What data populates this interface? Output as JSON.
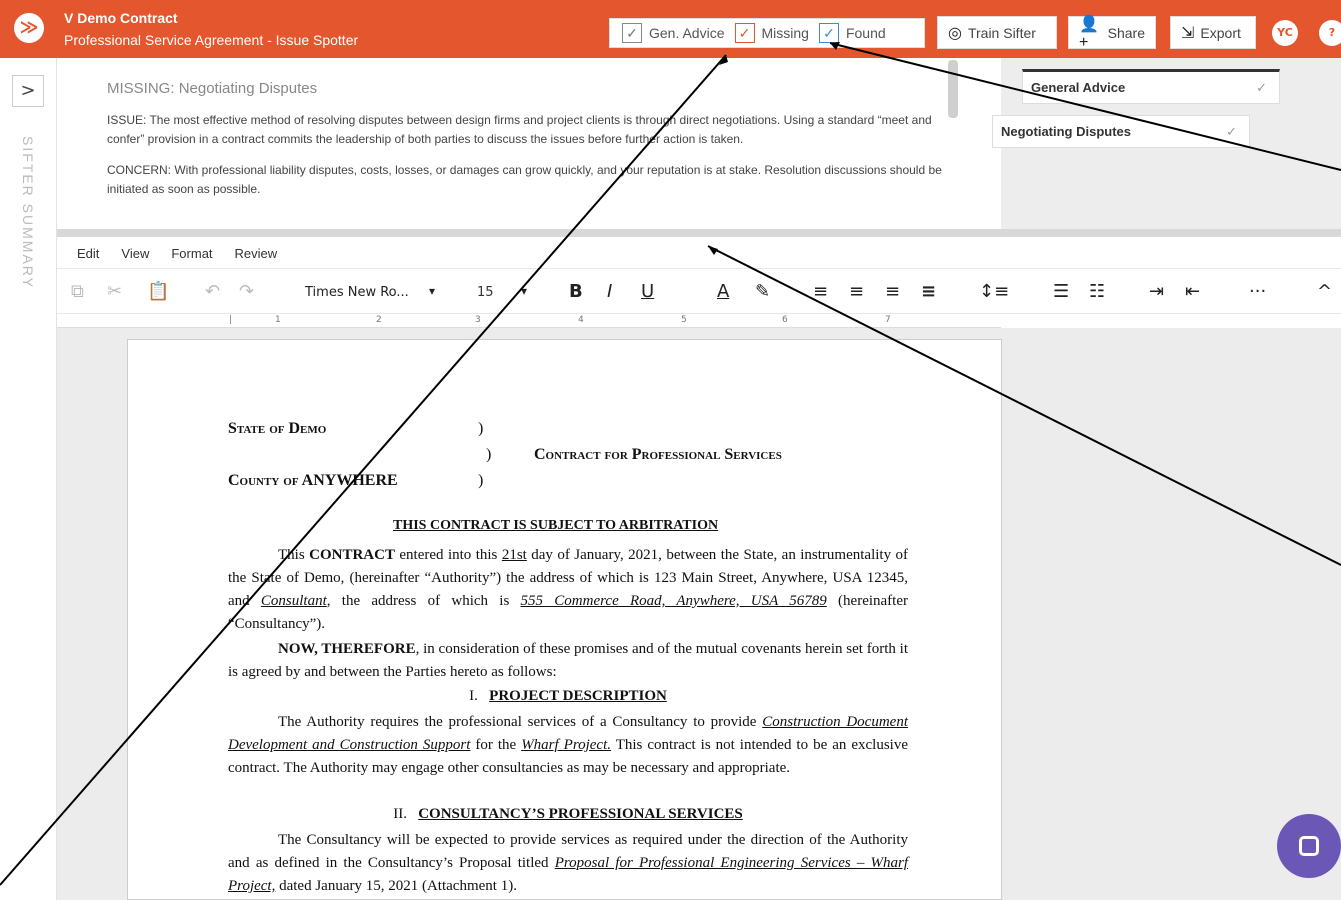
{
  "header": {
    "title": "V Demo Contract",
    "subtitle": "Professional Service Agreement - Issue Spotter",
    "filters": [
      {
        "label": "Gen. Advice",
        "checked": true
      },
      {
        "label": "Missing",
        "checked": true
      },
      {
        "label": "Found",
        "checked": true
      }
    ],
    "train_label": "Train Sifter",
    "share_label": "Share",
    "export_label": "Export",
    "avatar": "YC",
    "help": "?"
  },
  "sidebar": {
    "label": "SIFTER SUMMARY"
  },
  "summary": {
    "missing_prefix": "MISSING:",
    "missing_title": "Negotiating Disputes",
    "issue_text": "ISSUE: The most effective method of resolving disputes between design firms and project clients is through direct negotiations. Using a standard “meet and confer” provision in a contract commits the leadership of both parties to discuss the issues before further action is taken.",
    "concern_text": "CONCERN: With professional liability disputes, costs, losses, or damages can grow quickly, and your reputation is at stake. Resolution discussions should be initiated as soon as possible."
  },
  "rightpanel": {
    "cards": [
      {
        "label": "General Advice",
        "check": "✓"
      },
      {
        "label": "Negotiating Disputes",
        "check": "✓"
      }
    ]
  },
  "editor": {
    "menu": [
      "Edit",
      "View",
      "Format",
      "Review"
    ],
    "font": "Times New Ro...",
    "size": "15"
  },
  "document": {
    "state": "State of Demo",
    "county": "County of ANYWHERE",
    "paren": ")",
    "contract_title": "Contract for Professional Services",
    "arbitration": "THIS CONTRACT IS SUBJECT TO ARBITRATION",
    "para1_a": "This ",
    "para1_b": "CONTRACT",
    "para1_c": " entered into this ",
    "para1_date": "21st",
    "para1_d": " day of January, 2021, between the State, an instrumentality of the State of Demo, (hereinafter “Authority”) the address of which is 123 Main Street, Anywhere, USA 12345, and ",
    "para1_consultant": "Consultant",
    "para1_e": ", the address of which is ",
    "para1_address": "555 Commerce Road, Anywhere, USA 56789",
    "para1_f": " (hereinafter “Consultancy”).",
    "now_a": "NOW, THEREFORE",
    "now_b": ", in consideration of these promises and of the mutual covenants herein set forth it is agreed by and between the Parties hereto as follows:",
    "section1_num": "I.",
    "section1_title": "PROJECT DESCRIPTION",
    "para2_a": "The Authority requires the professional services of a Consultancy to provide ",
    "para2_link1": "Construction Document Development and Construction Support",
    "para2_b": " for the ",
    "para2_link2": "Wharf Project.",
    "para2_c": " This contract is not intended to be an exclusive contract. The Authority may engage other consultancies as may be necessary and appropriate.",
    "section2_num": "II.",
    "section2_title": "CONSULTANCY’S PROFESSIONAL SERVICES",
    "para3_a": "The Consultancy will be expected to provide services as required under the direction of the Authority and as defined in the Consultancy’s Proposal titled ",
    "para3_link": "Proposal for Professional Engineering Services – Wharf Project,",
    "para3_b": " dated January 15, 2021 (Attachment 1)."
  }
}
